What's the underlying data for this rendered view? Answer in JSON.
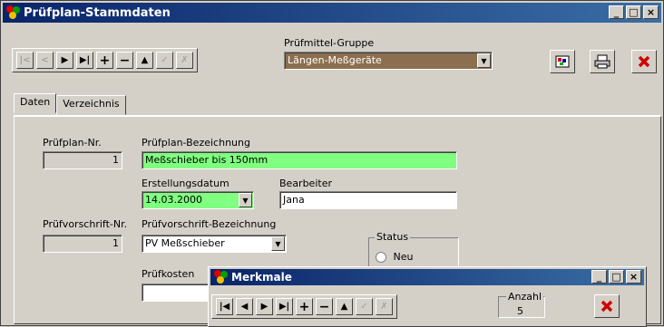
{
  "window": {
    "title": "Prüfplan-Stammdaten"
  },
  "nav": {
    "first": "|<",
    "prev": "<",
    "next": ">",
    "last": ">|",
    "add": "+",
    "delete": "−",
    "up": "▲",
    "confirm": "✓",
    "cancel": "✗"
  },
  "group": {
    "label": "Prüfmittel-Gruppe",
    "value": "Längen-Meßgeräte"
  },
  "tabs": [
    "Daten",
    "Verzeichnis"
  ],
  "form": {
    "plan_nr_label": "Prüfplan-Nr.",
    "plan_nr_value": "1",
    "plan_name_label": "Prüfplan-Bezeichnung",
    "plan_name_value": "Meßschieber bis 150mm",
    "date_label": "Erstellungsdatum",
    "date_value": "14.03.2000",
    "editor_label": "Bearbeiter",
    "editor_value": "Jana",
    "rule_nr_label": "Prüfvorschrift-Nr.",
    "rule_nr_value": "1",
    "rule_name_label": "Prüfvorschrift-Bezeichnung",
    "rule_name_value": "PV Meßschieber",
    "status_label": "Status",
    "status_option": "Neu",
    "costs_label": "Prüfkosten",
    "costs_value": ""
  },
  "sub": {
    "title": "Merkmale",
    "count_label": "Anzahl",
    "count_value": "5"
  },
  "colors": {
    "green_field": "#80ff80",
    "delete_red": "#d00000",
    "title_blue": "#0a246a"
  }
}
